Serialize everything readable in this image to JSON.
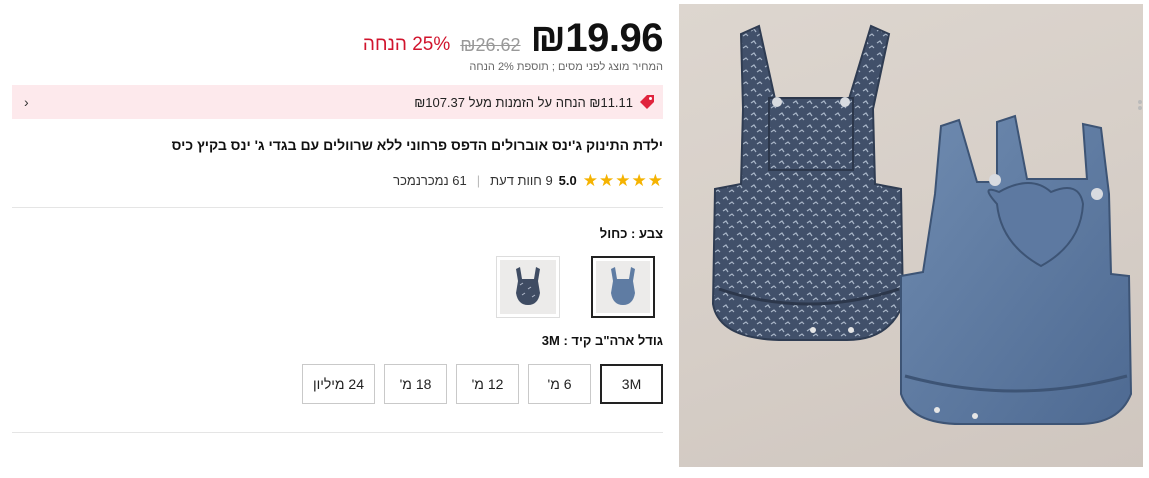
{
  "price": {
    "current": "₪19.96",
    "original": "₪26.62",
    "discount": "25% הנחה",
    "tax_note": "המחיר מוצג לפני מסים ; תוספת 2% הנחה"
  },
  "coupon": {
    "text": "₪11.11 הנחה על הזמנות מעל ₪107.37",
    "icon": "tag-icon",
    "arrow": "‹"
  },
  "product": {
    "title": "ילדת התינוק ג'ינס אוברולים הדפס פרחוני ללא שרוולים עם בגדי ג' ינס בקיץ כיס"
  },
  "rating": {
    "value": "5.0",
    "stars": 5,
    "reviews": "9 חוות דעת",
    "sold": "61 נמכרנמכר"
  },
  "color": {
    "label": "צבע : כחול",
    "options": [
      "כחול",
      "כחול כהה"
    ],
    "selected": 0
  },
  "size": {
    "label": "גודל ארה\"ב קיד : 3M",
    "options": [
      "3M",
      "6 מ'",
      "12 מ'",
      "18 מ'",
      "24 מיליון"
    ],
    "selected": 0
  },
  "colors": {
    "discount_red": "#d1142d",
    "banner_bg": "#fde9ec",
    "star_yellow": "#f5b301"
  }
}
